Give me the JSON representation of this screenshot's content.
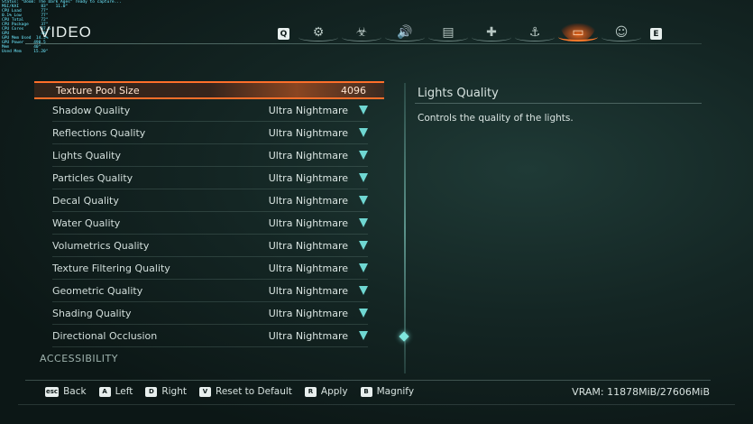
{
  "overlay": {
    "lines": [
      "Status: \"Doom: The Dark Ages\" ready to capture...",
      "MSI/KAI         83°   11.0°",
      "CPU Load        77°",
      "0.1% Low        77°",
      "CPU Total       72°",
      "CPU Package     37°",
      "CPU Cores       37.5",
      "GPU             40°",
      "GPU Mem Used  14.5%",
      "GPU Power    490.5",
      "Mem          40°",
      "Used Mem     15.20°"
    ]
  },
  "header": {
    "title": "VIDEO",
    "left_key": "Q",
    "right_key": "E",
    "tabs": [
      {
        "name": "gameplay-tab",
        "icon": "⚙",
        "active": false
      },
      {
        "name": "difficulty-tab",
        "icon": "☣",
        "active": false
      },
      {
        "name": "audio-tab",
        "icon": "🔊",
        "active": false
      },
      {
        "name": "hud-tab",
        "icon": "▤",
        "active": false
      },
      {
        "name": "controls-tab",
        "icon": "✚",
        "active": false
      },
      {
        "name": "keybinds-tab",
        "icon": "⚓",
        "active": false
      },
      {
        "name": "video-tab",
        "icon": "▭",
        "active": true
      },
      {
        "name": "accessibility-tab",
        "icon": "☺",
        "active": false
      }
    ]
  },
  "settings": {
    "highlighted": {
      "label": "Texture Pool Size",
      "value": "4096"
    },
    "rows": [
      {
        "label": "Shadow Quality",
        "value": "Ultra Nightmare"
      },
      {
        "label": "Reflections Quality",
        "value": "Ultra Nightmare"
      },
      {
        "label": "Lights Quality",
        "value": "Ultra Nightmare"
      },
      {
        "label": "Particles Quality",
        "value": "Ultra Nightmare"
      },
      {
        "label": "Decal Quality",
        "value": "Ultra Nightmare"
      },
      {
        "label": "Water Quality",
        "value": "Ultra Nightmare"
      },
      {
        "label": "Volumetrics Quality",
        "value": "Ultra Nightmare"
      },
      {
        "label": "Texture Filtering Quality",
        "value": "Ultra Nightmare"
      },
      {
        "label": "Geometric Quality",
        "value": "Ultra Nightmare"
      },
      {
        "label": "Shading Quality",
        "value": "Ultra Nightmare"
      },
      {
        "label": "Directional Occlusion",
        "value": "Ultra Nightmare"
      }
    ],
    "section_header": "ACCESSIBILITY"
  },
  "details": {
    "title": "Lights Quality",
    "description": "Controls the quality of the lights."
  },
  "footer": {
    "actions": [
      {
        "key": "esc",
        "label": "Back"
      },
      {
        "key": "A",
        "label": "Left"
      },
      {
        "key": "D",
        "label": "Right"
      },
      {
        "key": "V",
        "label": "Reset to Default"
      },
      {
        "key": "R",
        "label": "Apply"
      },
      {
        "key": "B",
        "label": "Magnify"
      }
    ],
    "vram": "VRAM: 11878MiB/27606MiB"
  },
  "colors": {
    "accent": "#6fd7d2",
    "highlight": "#ff6f2a"
  }
}
